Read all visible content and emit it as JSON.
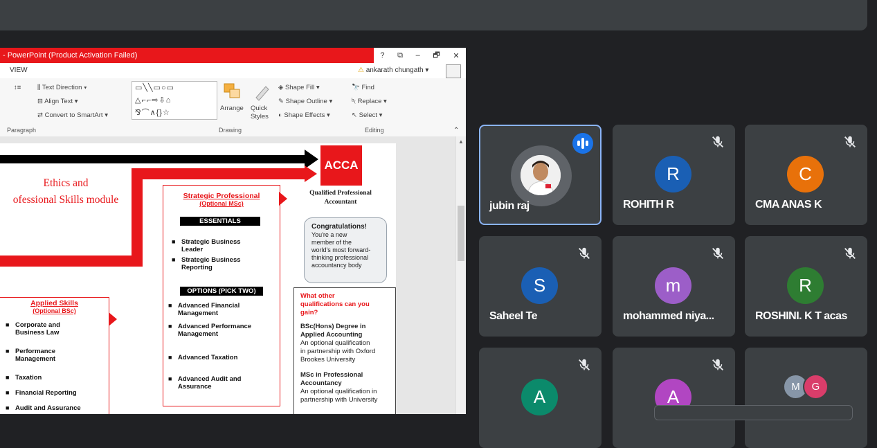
{
  "ppt": {
    "title": "- PowerPoint (Product Activation Failed)",
    "controls": {
      "help": "?",
      "restore": "⧉",
      "minimize": "–",
      "maximize": "🗗",
      "close": "✕"
    },
    "menu_view": "VIEW",
    "user_name": "ankarath chungath",
    "user_caret": "▾",
    "ribbon": {
      "text_direction": "Text Direction",
      "align_text": "Align Text",
      "convert_smartart": "Convert to SmartArt",
      "paragraph_group": "Paragraph",
      "arrange": "Arrange",
      "quick_styles": "Quick Styles",
      "shape_fill": "Shape Fill",
      "shape_outline": "Shape Outline",
      "shape_effects": "Shape Effects",
      "drawing_group": "Drawing",
      "find": "Find",
      "replace": "Replace",
      "select": "Select",
      "editing_group": "Editing"
    },
    "slide": {
      "ethics_line1": "Ethics and",
      "ethics_line2": "ofessional Skills module",
      "acca": "ACCA",
      "qpa_line1": "Qualified Professional",
      "qpa_line2": "Accountant",
      "strategic_title": "Strategic Professional",
      "strategic_sub": "(Optional MSc)",
      "essentials": "ESSENTIALS",
      "essential_items": [
        [
          "Strategic Business",
          "Leader"
        ],
        [
          "Strategic Business",
          "Reporting"
        ]
      ],
      "options_label": "OPTIONS (PICK TWO)",
      "option_items": [
        [
          "Advanced Financial",
          "Management"
        ],
        [
          "Advanced Performance",
          "Management"
        ],
        [
          "Advanced Taxation",
          ""
        ],
        [
          "Advanced Audit and",
          "Assurance"
        ]
      ],
      "applied_title": "Applied Skills",
      "applied_sub": "(Optional BSc)",
      "applied_items": [
        [
          "Corporate and",
          "Business Law"
        ],
        [
          "Performance",
          "Management"
        ],
        [
          "Taxation",
          ""
        ],
        [
          "Financial Reporting",
          ""
        ],
        [
          "Audit and Assurance",
          ""
        ]
      ],
      "congrats_title": "Congratulations!",
      "congrats_body": [
        "You're a new",
        "member of the",
        "world's most forward-",
        "thinking professional",
        "accountancy body"
      ],
      "qual_title": [
        "What other",
        "qualifications can you",
        "gain?"
      ],
      "bsc_title": [
        "BSc(Hons) Degree in",
        "Applied Accounting"
      ],
      "bsc_body": [
        "An optional qualification",
        "in partnership with Oxford",
        "Brookes University"
      ],
      "msc_title": [
        "MSc in Professional",
        "Accountancy"
      ],
      "msc_body": [
        "An optional qualification in",
        "partnership with University"
      ]
    }
  },
  "participants": [
    {
      "name": "jubin raj",
      "initial": "",
      "color": "",
      "status": "speaking",
      "photo": true
    },
    {
      "name": "ROHITH R",
      "initial": "R",
      "color": "#1a5fb4",
      "status": "muted"
    },
    {
      "name": "CMA ANAS K",
      "initial": "C",
      "color": "#e8710a",
      "status": "muted"
    },
    {
      "name": "Saheel Te",
      "initial": "S",
      "color": "#1a5fb4",
      "status": "muted"
    },
    {
      "name": "mohammed niya...",
      "initial": "m",
      "color": "#9c5ec8",
      "status": "muted"
    },
    {
      "name": "ROSHINI. K T acas",
      "initial": "R",
      "color": "#2e7d32",
      "status": "muted"
    },
    {
      "name": "",
      "initial": "A",
      "color": "#0b8a6b",
      "status": "muted"
    },
    {
      "name": "",
      "initial": "A",
      "color": "#b146c2",
      "status": "muted"
    },
    {
      "name": "",
      "initial": "",
      "color": "",
      "status": "group",
      "group_initials": [
        "M",
        "G"
      ],
      "group_colors": [
        "#8796a8",
        "#d93d6a"
      ]
    }
  ]
}
